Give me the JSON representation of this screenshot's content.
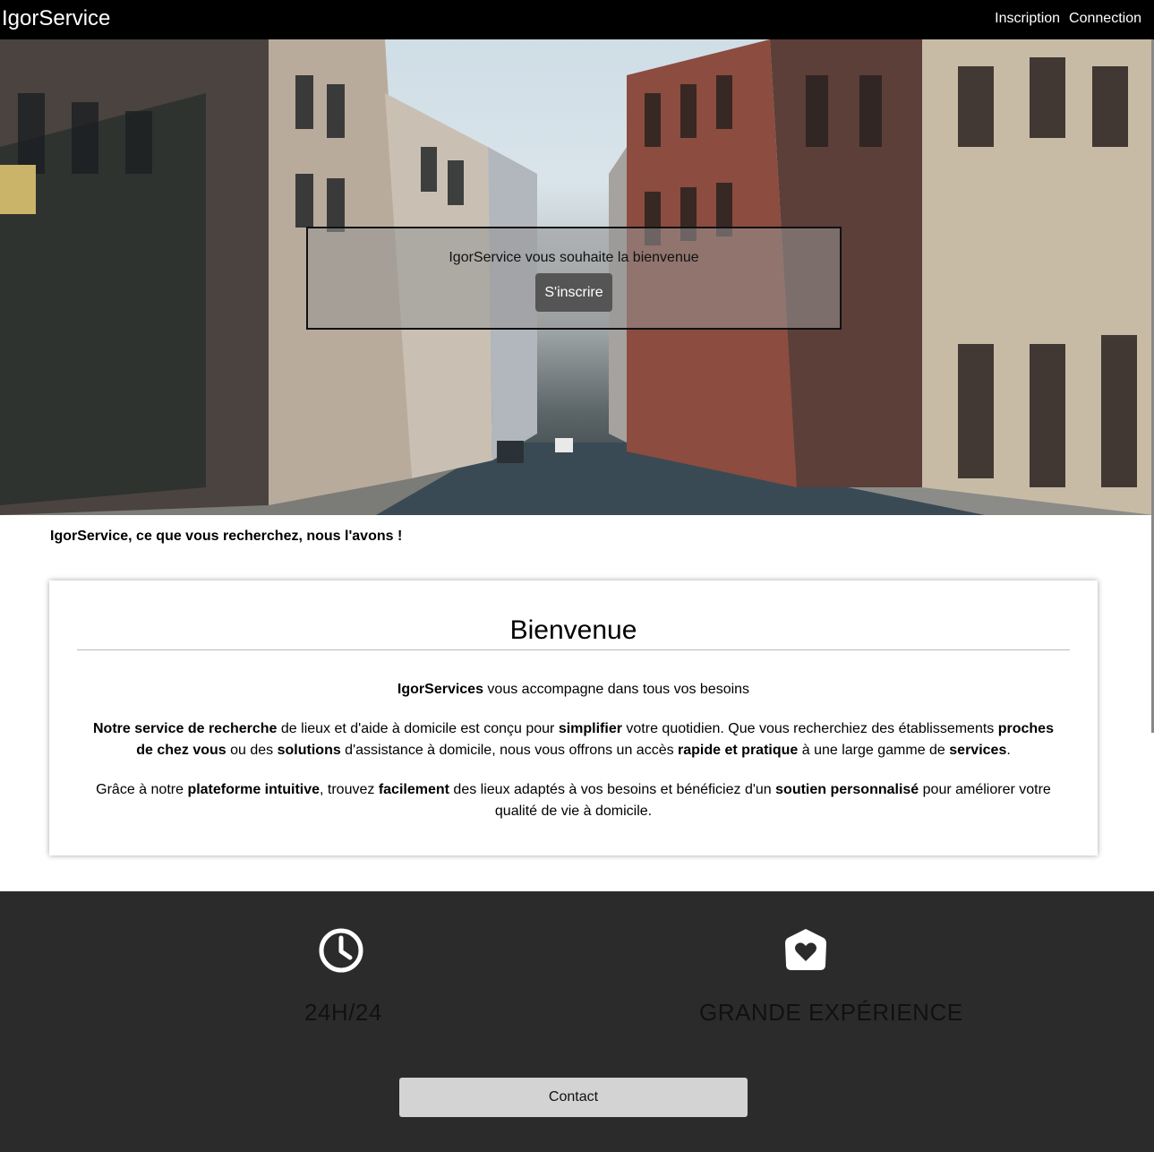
{
  "nav": {
    "brand": "IgorService",
    "links": [
      "Inscription",
      "Connection"
    ]
  },
  "hero": {
    "welcome": "IgorService vous souhaite la bienvenue",
    "signup_label": "S'inscrire"
  },
  "tagline": "IgorService, ce que vous recherchez, nous l'avons !",
  "card": {
    "title": "Bienvenue",
    "p1": [
      {
        "b": true,
        "t": "IgorServices"
      },
      {
        "b": false,
        "t": " vous accompagne dans tous vos besoins"
      }
    ],
    "p2": [
      {
        "b": true,
        "t": "Notre service de recherche"
      },
      {
        "b": false,
        "t": " de lieux et d'aide à domicile est conçu pour "
      },
      {
        "b": true,
        "t": "simplifier"
      },
      {
        "b": false,
        "t": " votre quotidien. Que vous recherchiez des établissements "
      },
      {
        "b": true,
        "t": "proches de chez vous"
      },
      {
        "b": false,
        "t": " ou des "
      },
      {
        "b": true,
        "t": "solutions"
      },
      {
        "b": false,
        "t": " d'assistance à domicile, nous vous offrons un accès "
      },
      {
        "b": true,
        "t": "rapide et pratique"
      },
      {
        "b": false,
        "t": " à une large gamme de "
      },
      {
        "b": true,
        "t": "services"
      },
      {
        "b": false,
        "t": "."
      }
    ],
    "p3": [
      {
        "b": false,
        "t": "Grâce à notre "
      },
      {
        "b": true,
        "t": "plateforme intuitive"
      },
      {
        "b": false,
        "t": ", trouvez "
      },
      {
        "b": true,
        "t": "facilement"
      },
      {
        "b": false,
        "t": " des lieux adaptés à vos besoins et bénéficiez d'un "
      },
      {
        "b": true,
        "t": "soutien personnalisé"
      },
      {
        "b": false,
        "t": " pour améliorer votre qualité de vie à domicile."
      }
    ]
  },
  "features": [
    {
      "icon": "clock-icon",
      "label": "24H/24"
    },
    {
      "icon": "heart-shield-icon",
      "label": "GRANDE EXPÉRIENCE"
    }
  ],
  "contact_label": "Contact",
  "colors": {
    "nav_bg": "#000000",
    "dark_section": "#2b2b2b",
    "signup_btn": "#555555",
    "contact_btn": "#d3d3d3"
  }
}
